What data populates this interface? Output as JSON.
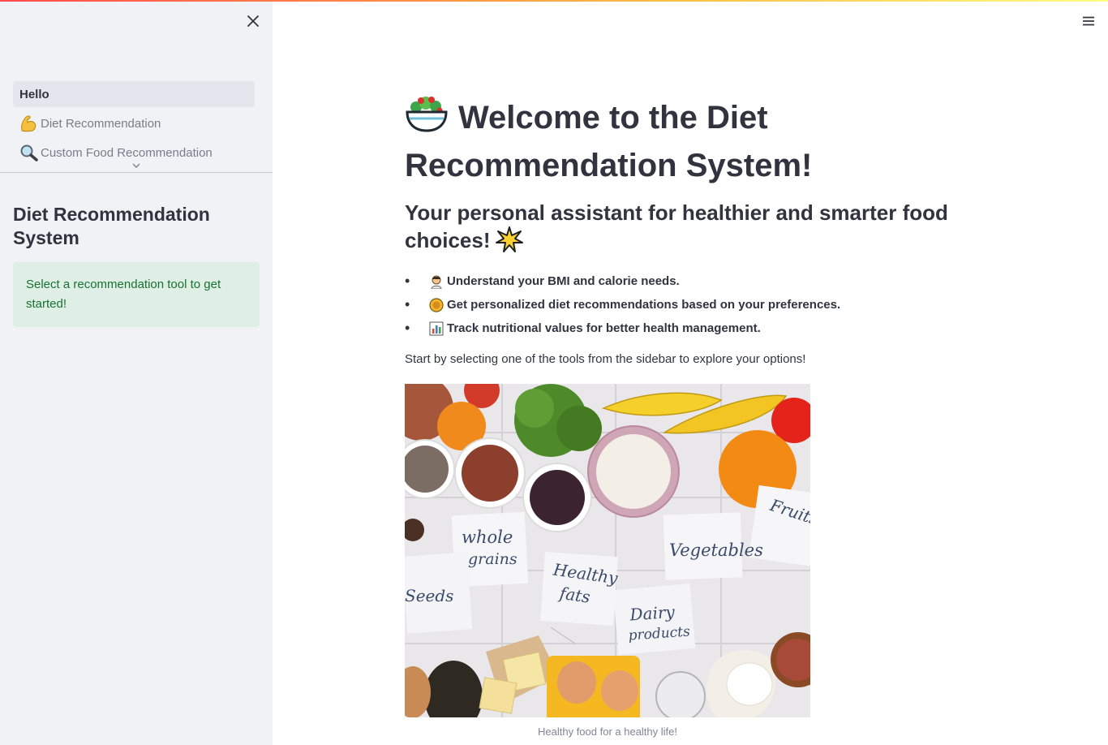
{
  "sidebar": {
    "nav_items": [
      {
        "label": "Hello",
        "icon": "none",
        "active": true
      },
      {
        "label": "Diet Recommendation",
        "icon": "flexed-bicep-icon",
        "active": false
      },
      {
        "label": "Custom Food Recommendation",
        "icon": "magnifier-icon",
        "active": false
      }
    ],
    "title": "Diet Recommendation System",
    "alert_text": "Select a recommendation tool to get started!"
  },
  "main": {
    "title": "Welcome to the Diet Recommendation System!",
    "subtitle": "Your personal assistant for healthier and smarter food choices!",
    "bullets": [
      {
        "icon": "person-icon",
        "text": "Understand your BMI and calorie needs."
      },
      {
        "icon": "food-plate-icon",
        "text": "Get personalized diet recommendations based on your preferences."
      },
      {
        "icon": "bar-chart-icon",
        "text": "Track nutritional values for better health management."
      }
    ],
    "intro": "Start by selecting one of the tools from the sidebar to explore your options!",
    "image_labels": {
      "whole_grains_1": "whole",
      "whole_grains_2": "grains",
      "healthy_fats_1": "Healthy",
      "healthy_fats_2": "fats",
      "vegetables": "Vegetables",
      "dairy_1": "Dairy",
      "dairy_2": "products",
      "seeds": "Seeds",
      "fruits": "Fruits"
    },
    "caption": "Healthy food for a healthy life!"
  },
  "colors": {
    "sidebar_bg": "#f0f2f6",
    "alert_bg": "#dfefe5",
    "alert_text": "#177233",
    "text": "#31333f"
  }
}
